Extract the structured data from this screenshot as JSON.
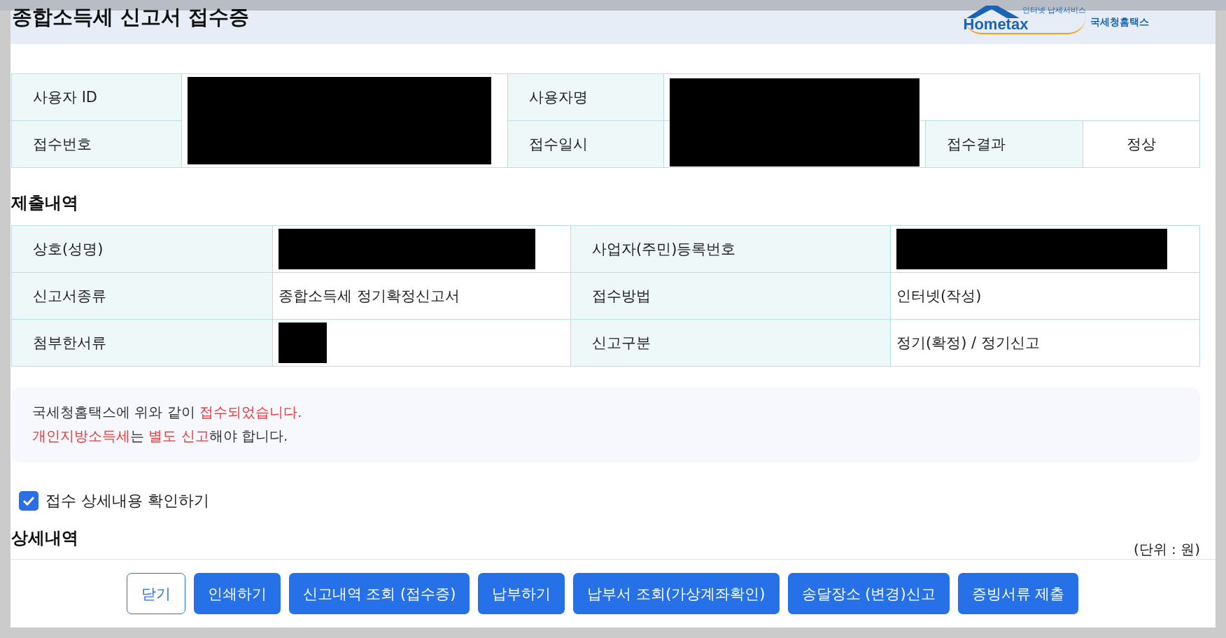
{
  "header": {
    "title": "종합소득세 신고서 접수증",
    "logo": {
      "caption": "인터넷 납세서비스",
      "wordmark": "Hometax",
      "service": "국세청홈택스"
    }
  },
  "receipt": {
    "user_id_label": "사용자 ID",
    "user_id": {
      "redacted": true
    },
    "user_name_label": "사용자명",
    "user_name": {
      "redacted": true
    },
    "receipt_no_label": "접수번호",
    "receipt_date_label": "접수일시",
    "result_label": "접수결과",
    "result": "정상"
  },
  "submission": {
    "heading": "제출내역",
    "rows": [
      {
        "label": "상호(성명)",
        "value": {
          "redacted": true
        },
        "label_2": "사업자(주민)등록번호",
        "value_2": {
          "redacted": true
        }
      },
      {
        "label": "신고서종류",
        "value": {
          "redacted": false,
          "text": "종합소득세 정기확정신고서"
        },
        "label_2": "접수방법",
        "value_2": {
          "redacted": false,
          "text": "인터넷(작성)"
        }
      },
      {
        "label": "첨부한서류",
        "value": {
          "redacted": true
        },
        "label_2": "신고구분",
        "value_2": {
          "redacted": false,
          "text": "정기(확정) / 정기신고"
        }
      }
    ]
  },
  "notice": {
    "lines": [
      [
        {
          "text": "국세청홈택스에 위와 같이 ",
          "highlight": false
        },
        {
          "text": "접수되었습니다.",
          "highlight": true
        }
      ],
      [
        {
          "text": "개인지방소득세",
          "highlight": true
        },
        {
          "text": "는 ",
          "highlight": false
        },
        {
          "text": "별도 신고",
          "highlight": true
        },
        {
          "text": "해야 합니다.",
          "highlight": false
        }
      ]
    ]
  },
  "detail_toggle": {
    "label": "접수 상세내용 확인하기",
    "checked": true
  },
  "details": {
    "heading": "상세내역",
    "unit": "(단위 : 원)"
  },
  "buttons": [
    {
      "label": "닫기",
      "kind": "outline"
    },
    {
      "label": "인쇄하기",
      "kind": "primary"
    },
    {
      "label": "신고내역 조회 (접수증)",
      "kind": "primary"
    },
    {
      "label": "납부하기",
      "kind": "primary"
    },
    {
      "label": "납부서 조회(가상계좌확인)",
      "kind": "primary"
    },
    {
      "label": "송달장소 (변경)신고",
      "kind": "primary"
    },
    {
      "label": "증빙서류 제출",
      "kind": "primary"
    }
  ]
}
